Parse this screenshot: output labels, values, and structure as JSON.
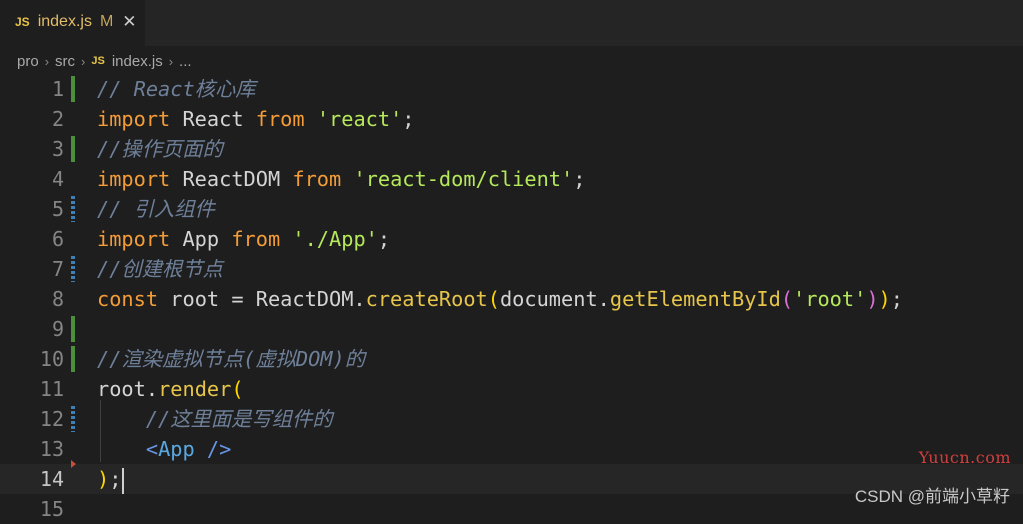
{
  "tab": {
    "icon": "JS",
    "filename": "index.js",
    "modified_flag": "M",
    "close": "✕"
  },
  "breadcrumb": {
    "segments": [
      "pro",
      "src"
    ],
    "file_icon": "JS",
    "file": "index.js",
    "tail": "..."
  },
  "editor": {
    "lines": [
      {
        "num": "1",
        "marker": "added"
      },
      {
        "num": "2",
        "marker": "none"
      },
      {
        "num": "3",
        "marker": "added"
      },
      {
        "num": "4",
        "marker": "none"
      },
      {
        "num": "5",
        "marker": "modified"
      },
      {
        "num": "6",
        "marker": "none"
      },
      {
        "num": "7",
        "marker": "modified"
      },
      {
        "num": "8",
        "marker": "none"
      },
      {
        "num": "9",
        "marker": "added"
      },
      {
        "num": "10",
        "marker": "added"
      },
      {
        "num": "11",
        "marker": "none"
      },
      {
        "num": "12",
        "marker": "modified"
      },
      {
        "num": "13",
        "marker": "none"
      },
      {
        "num": "14",
        "marker": "none"
      },
      {
        "num": "15",
        "marker": "none"
      }
    ],
    "tokens": {
      "l1": "// React核心库",
      "l2_kw1": "import",
      "l2_id": " React ",
      "l2_kw2": "from",
      "l2_str": "'react'",
      "l2_end": ";",
      "l3": "//操作页面的",
      "l4_kw1": "import",
      "l4_id": " ReactDOM ",
      "l4_kw2": "from",
      "l4_str": "'react-dom/client'",
      "l4_end": ";",
      "l5": "// 引入组件",
      "l6_kw1": "import",
      "l6_id": " App ",
      "l6_kw2": "from",
      "l6_str": "'./App'",
      "l6_end": ";",
      "l7": "//创建根节点",
      "l8_kw": "const",
      "l8_a": " root = ReactDOM.",
      "l8_fn1": "createRoot",
      "l8_p1": "(",
      "l8_b": "document.",
      "l8_fn2": "getElementById",
      "l8_p2": "(",
      "l8_str": "'root'",
      "l8_p3": ")",
      "l8_p4": ")",
      "l8_end": ";",
      "l10": "//渲染虚拟节点(虚拟DOM)的",
      "l11_a": "root.",
      "l11_fn": "render",
      "l11_p": "(",
      "l12": "//这里面是写组件的",
      "l13_open": "<",
      "l13_tag": "App",
      "l13_close": " />",
      "l14_p": ")",
      "l14_end": ";"
    }
  },
  "watermarks": {
    "site": "Yuucn.com",
    "credit": "CSDN @前端小草籽"
  },
  "colors": {
    "background": "#1e1e1e",
    "keyword": "#f39c38",
    "string": "#b5e85a",
    "comment": "#6e7f99",
    "function": "#e6c54a",
    "jsx_tag": "#5aa8e0",
    "added_marker": "#4b8f3a",
    "modified_marker": "#3f7fb3"
  }
}
